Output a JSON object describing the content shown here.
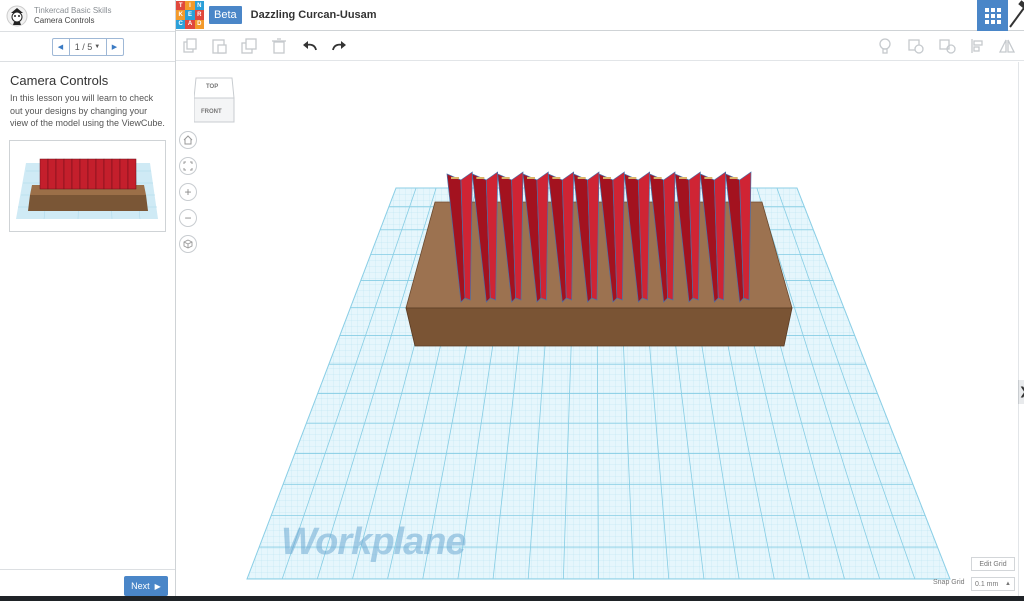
{
  "lesson": {
    "course_title": "Tinkercad Basic Skills",
    "step_title": "Camera Controls",
    "page": "1 / 5",
    "heading": "Camera Controls",
    "description": "In this lesson you will learn to check out your designs by changing your view of the model using the ViewCube.",
    "next_label": "Next"
  },
  "topbar": {
    "logo_letters": [
      "T",
      "I",
      "N",
      "K",
      "E",
      "R",
      "C",
      "A",
      "D"
    ],
    "logo_colors": [
      "#e0483c",
      "#f39a2b",
      "#2b9fd8",
      "#f39a2b",
      "#2b9fd8",
      "#e0483c",
      "#2b9fd8",
      "#e0483c",
      "#f39a2b"
    ],
    "beta_label": "Beta",
    "design_name": "Dazzling Curcan-Uusam"
  },
  "toolbar": {
    "icons": [
      "copy-icon",
      "paste-icon",
      "duplicate-icon",
      "delete-icon",
      "undo-icon",
      "redo-icon",
      "lightbulb-icon",
      "group-icon",
      "ungroup-icon",
      "align-icon",
      "mirror-icon"
    ]
  },
  "canvas": {
    "viewcube_top": "TOP",
    "viewcube_front": "FRONT",
    "workplane_label": "Workplane",
    "edit_grid_label": "Edit Grid",
    "snap_grid_label": "Snap Grid",
    "snap_grid_value": "0.1 mm",
    "right_tab_glyph": "❯"
  },
  "colors": {
    "accent": "#4a86c8",
    "grid": "#9fd3e8",
    "box": "#8a6040",
    "walls": "#c41f2c"
  }
}
